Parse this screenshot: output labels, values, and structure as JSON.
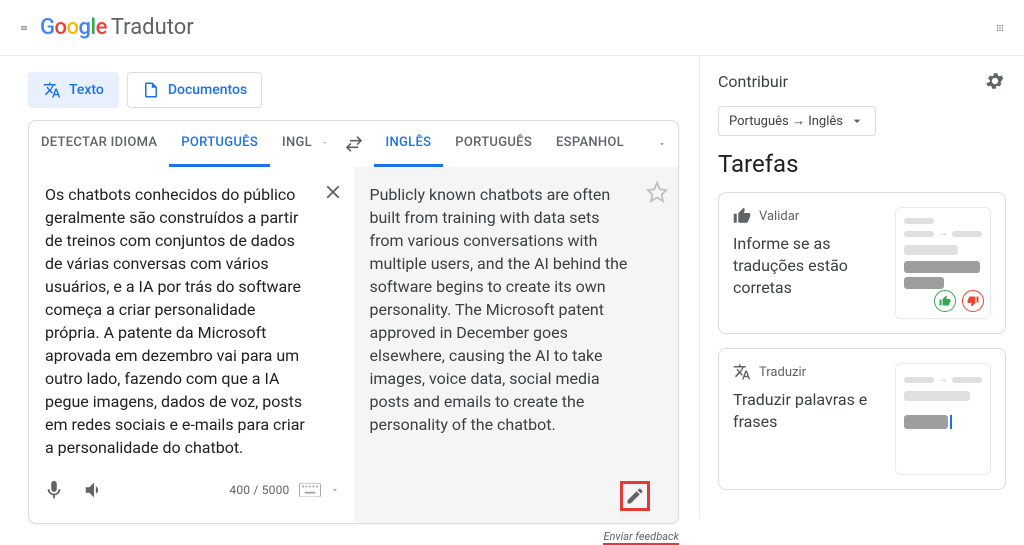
{
  "brand": {
    "product": "Tradutor"
  },
  "modes": {
    "text": "Texto",
    "documents": "Documentos"
  },
  "source": {
    "tabs": {
      "detect": "DETECTAR IDIOMA",
      "pt": "PORTUGUÊS",
      "en": "INGLÊS"
    },
    "text": "Os chatbots conhecidos do público geralmente são construídos a partir de treinos com conjuntos de dados de várias conversas com vários usuários, e a IA por trás do software começa a criar personalidade própria. A patente da Microsoft aprovada em dezembro vai para um outro lado, fazendo com que a IA pegue imagens, dados de voz, posts em redes sociais e e-mails para criar a personalidade do chatbot.",
    "charcount": "400 / 5000"
  },
  "target": {
    "tabs": {
      "en": "INGLÊS",
      "pt": "PORTUGUÊS",
      "es": "ESPANHOL"
    },
    "text": "Publicly known chatbots are often built from training with data sets from various conversations with multiple users, and the AI behind the software begins to create its own personality. The Microsoft patent approved in December goes elsewhere, causing the AI to take images, voice data, social media posts and emails to create the personality of the chatbot."
  },
  "feedback_label": "Enviar feedback",
  "sidebar": {
    "title": "Contribuir",
    "lang_pair": "Português → Inglês",
    "heading": "Tarefas",
    "task1": {
      "label": "Validar",
      "desc": "Informe se as traduções estão corretas"
    },
    "task2": {
      "label": "Traduzir",
      "desc": "Traduzir palavras e frases"
    }
  }
}
